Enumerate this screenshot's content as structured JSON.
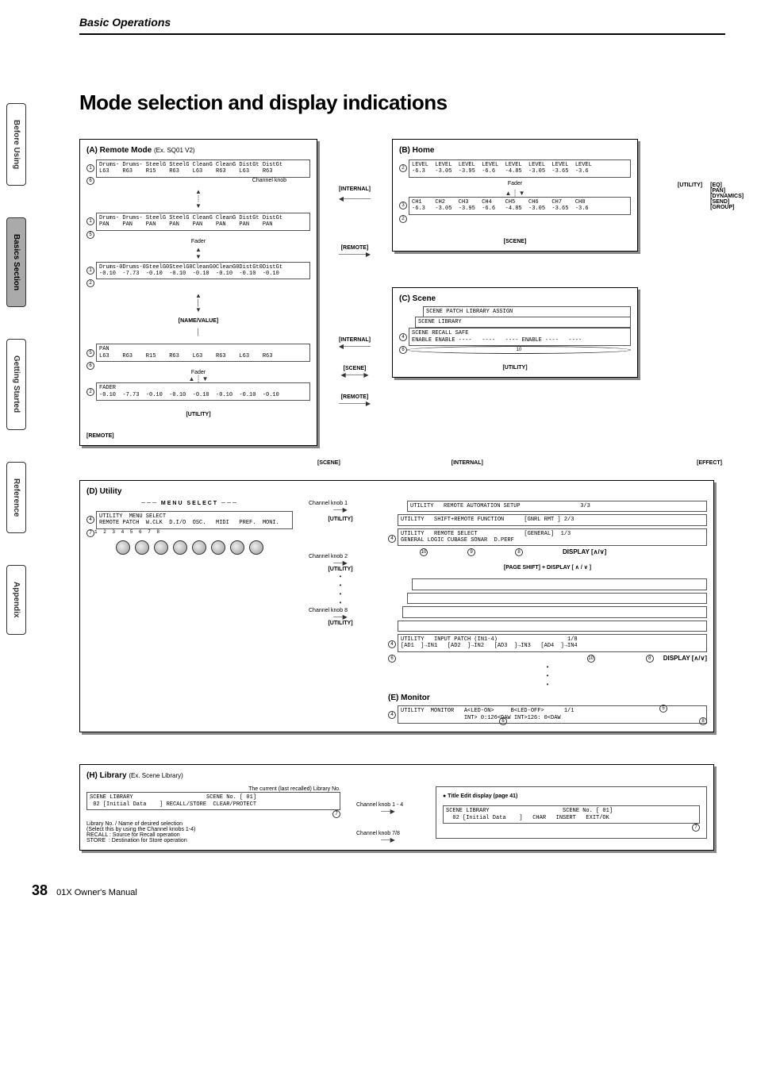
{
  "running_header": "Basic Operations",
  "side_tabs": {
    "before_using": "Before Using",
    "basics_section": "Basics Section",
    "getting_started": "Getting Started",
    "reference": "Reference",
    "appendix": "Appendix"
  },
  "main_title": "Mode selection and display indications",
  "panel_a": {
    "title": "(A) Remote Mode",
    "sub": "(Ex. SQ01 V2)",
    "lcd1_line1": "Drums- Drums- SteelG SteelG CleanG CleanG DistGt DistGt",
    "lcd1_line2": "L63    R63    R15    R63    L63    R63    L63    R63",
    "lcd2_line1": "Drums- Drums- SteelG SteelG CleanG CleanG DistGt DistGt",
    "lcd2_line2": "PAN    PAN    PAN    PAN    PAN    PAN    PAN    PAN",
    "lcd3_line1": "Drums-0Drums-0SteelG0SteelG0CleanG0CleanG0DistGt0DistGt",
    "lcd3_line2": "-0.10  -7.73  -0.10  -0.10  -0.10  -0.10  -0.10  -0.10",
    "lcd4_line1": "PAN",
    "lcd4_line2": "L63    R63    R15    R63    L63    R63    L63    R63",
    "lcd5_line1": "FADER",
    "lcd5_line2": "-0.10  -7.73  -0.10  -0.10  -0.10  -0.10  -0.10  -0.10",
    "channel_knob_label": "Channel knob",
    "fader_label": "Fader",
    "name_value": "[NAME/VALUE]",
    "utility_btn": "[UTILITY]",
    "remote_btn": "[REMOTE]",
    "ref1": "1",
    "ref2": "2",
    "ref5": "5",
    "ref6": "6"
  },
  "panel_b": {
    "title": "(B) Home",
    "lcd1_line1": "LEVEL  LEVEL  LEVEL  LEVEL  LEVEL  LEVEL  LEVEL  LEVEL",
    "lcd1_line2": "-6.3   -3.05  -3.95  -6.6   -4.85  -3.05  -3.65  -3.6",
    "lcd2_line1": "CH1    CH2    CH3    CH4    CH5    CH6    CH7    CH8",
    "lcd2_line2": "-6.3   -3.05  -3.95  -6.6   -4.85  -3.05  -3.65  -3.6",
    "fader_label": "Fader",
    "internal_btn": "[INTERNAL]",
    "remote_btn": "[REMOTE]",
    "utility_btn": "[UTILITY]",
    "scene_btn": "[SCENE]",
    "right_labels": "[EQ]\n[PAN]\n[DYNAMICS]\n[SEND]\n[GROUP]",
    "ref2": "2",
    "ref3": "3"
  },
  "panel_c": {
    "title": "(C) Scene",
    "lcd_line1": "SCENE PATCH LIBRARY ASSIGN",
    "lcd_line2": "SCENE LIBRARY",
    "lcd_line3": "SCENE RECALL SAFE",
    "lcd_line4": "ENABLE ENABLE ----   ----   ---- ENABLE ----   ----",
    "internal_btn": "[INTERNAL]",
    "scene_btn": "[SCENE]",
    "remote_btn": "[REMOTE]",
    "utility_btn": "[UTILITY]",
    "ref4": "4",
    "ref6": "6",
    "ref10": "10"
  },
  "middle_row": {
    "scene_btn": "[SCENE]",
    "internal_btn": "[INTERNAL]",
    "effect_btn": "[EFFECT]"
  },
  "panel_d": {
    "title": "(D) Utility",
    "menu_select": "MENU SELECT",
    "lcd_line1": "UTILITY  MENU SELECT",
    "lcd_line2": "REMOTE PATCH  W.CLK  D.I/O  OSC.   MIDI   PREF.  MONI.",
    "num_strip": "  1      2      3      4      5      6      7      8",
    "channel_knob1": "Channel knob 1",
    "channel_knob2": "Channel knob 2",
    "channel_knob8": "Channel knob 8",
    "utility_btn": "[UTILITY]",
    "ref4": "4",
    "ref7": "7",
    "stack_a_l1": "UTILITY   REMOTE AUTOMATION SETUP                  3/3",
    "stack_a_l2": "UTILITY   SHIFT+REMOTE FUNCTION      [GNRL RMT ] 2/3",
    "stack_a_l3": "UTILITY   REMOTE SELECT              [GENERAL]  1/3",
    "stack_a_l4": "GENERAL LOGIC CUBASE SONAR  D.PERF",
    "stack_a_ref8": "8",
    "stack_a_ref9": "9",
    "stack_a_ref10": "10",
    "page_shift": "[PAGE SHIFT] + DISPLAY [ ∧ / ∨ ]",
    "display_arrows": "DISPLAY [∧/∨]",
    "stack_b_l1": "UTILITY   INPUT PATCH (IN1-4)                     1/8",
    "stack_b_l2": "[AD1  ]→IN1   [AD2  ]→IN2   [AD3  ]→IN3   [AD4  ]→IN4",
    "stack_b_ref6": "6",
    "stack_b_ref8": "8",
    "stack_b_ref10": "10"
  },
  "panel_e": {
    "title": "(E) Monitor",
    "lcd_line1": "UTILITY  MONITOR   A<LED-ON>     B<LED-OFF>      1/1",
    "lcd_line2": "                   INT> 0:126<DAW INT>126: 0<DAW",
    "ref4": "4",
    "ref5": "5",
    "ref6": "6",
    "ref8": "8"
  },
  "panel_h": {
    "title": "(H) Library",
    "sub": "(Ex. Scene Library)",
    "note_current": "The current (last recalled) Library No.",
    "lcd_line1": "SCENE LIBRARY                      SCENE No. [ 01]",
    "lcd_line2": " 02 [Initial Data    ] RECALL/STORE  CLEAR/PROTECT",
    "note_below": "Library No. / Name of desired selection\n(Select this by using the Channel knobs 1-4)\nRECALL : Source for Recall operation\nSTORE  : Destination for Store operation",
    "ref7": "7",
    "channel_knob_14": "Channel knob 1 - 4",
    "channel_knob_78": "Channel knob 7/8",
    "title_edit": "● Title Edit display  (page 41)",
    "lcd2_line1": "SCENE LIBRARY                      SCENE No. [ 01]",
    "lcd2_line2": "  02 [Initial Data    ]   CHAR   INSERT   EXIT/OK"
  },
  "footer": {
    "page_number": "38",
    "book_title": "01X  Owner's Manual"
  }
}
